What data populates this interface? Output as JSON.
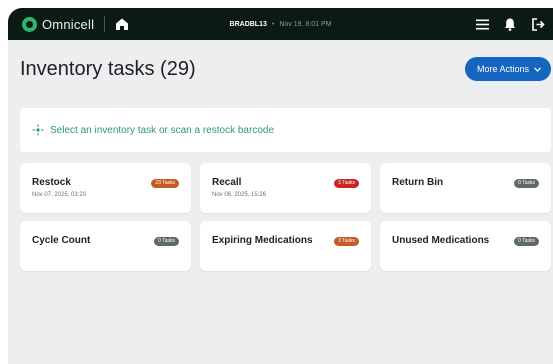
{
  "header": {
    "brand": "Omnicell",
    "user": "BRADBL13",
    "separator": "•",
    "datetime": "Nov 19, 8:01 PM",
    "icons": [
      "home-icon",
      "menu-icon",
      "bell-icon",
      "logout-icon"
    ]
  },
  "page": {
    "title": "Inventory tasks (29)",
    "more_actions_label": "More Actions",
    "scan_prompt": "Select an inventory task or scan a restock barcode"
  },
  "cards": [
    {
      "title": "Restock",
      "date": "Nov 07, 2025, 03:20",
      "badge": "23 Tasks",
      "badge_color": "#c45a24"
    },
    {
      "title": "Recall",
      "date": "Nov 06, 2025, 15:26",
      "badge": "3 Tasks",
      "badge_color": "#c8261f"
    },
    {
      "title": "Return Bin",
      "date": "",
      "badge": "0 Tasks",
      "badge_color": "#5e6a63"
    },
    {
      "title": "Cycle Count",
      "date": "",
      "badge": "0 Tasks",
      "badge_color": "#5e6a63"
    },
    {
      "title": "Expiring Medications",
      "date": "",
      "badge": "3 Tasks",
      "badge_color": "#c45a24"
    },
    {
      "title": "Unused Medications",
      "date": "",
      "badge": "0 Tasks",
      "badge_color": "#5e6a63"
    }
  ],
  "colors": {
    "header_bg": "#0c1a14",
    "brand_green": "#2bb673",
    "primary_blue": "#1565c0",
    "scan_text": "#2a9a6a",
    "page_bg": "#eceef0"
  }
}
